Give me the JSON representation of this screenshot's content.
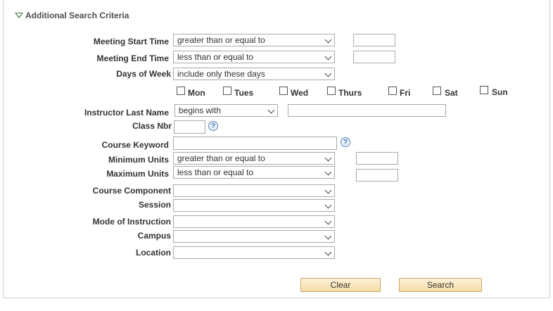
{
  "section": {
    "title": "Additional Search Criteria"
  },
  "fields": {
    "meeting_start_time": {
      "label": "Meeting Start Time",
      "operator": "greater than or equal to",
      "value": ""
    },
    "meeting_end_time": {
      "label": "Meeting End Time",
      "operator": "less than or equal to",
      "value": ""
    },
    "days_of_week": {
      "label": "Days of Week",
      "operator": "include only these days"
    },
    "days": [
      "Mon",
      "Tues",
      "Wed",
      "Thurs",
      "Fri",
      "Sat",
      "Sun"
    ],
    "instructor_last_name": {
      "label": "Instructor Last Name",
      "operator": "begins with",
      "value": ""
    },
    "class_nbr": {
      "label": "Class Nbr",
      "value": ""
    },
    "course_keyword": {
      "label": "Course Keyword",
      "value": ""
    },
    "minimum_units": {
      "label": "Minimum Units",
      "operator": "greater than or equal to",
      "value": ""
    },
    "maximum_units": {
      "label": "Maximum Units",
      "operator": "less than or equal to",
      "value": ""
    },
    "course_component": {
      "label": "Course Component",
      "value": ""
    },
    "session": {
      "label": "Session",
      "value": ""
    },
    "mode_of_instruction": {
      "label": "Mode of Instruction",
      "value": ""
    },
    "campus": {
      "label": "Campus",
      "value": ""
    },
    "location": {
      "label": "Location",
      "value": ""
    }
  },
  "help_glyph": "?",
  "buttons": {
    "clear": "Clear",
    "search": "Search"
  },
  "colors": {
    "accent": "#3a7d3a",
    "button_bg": "#f6dca4",
    "button_border": "#c9a76a"
  },
  "icons": {
    "expand": "triangle-down-icon",
    "help": "help-circle-icon",
    "dropdown": "chevron-down-icon"
  }
}
